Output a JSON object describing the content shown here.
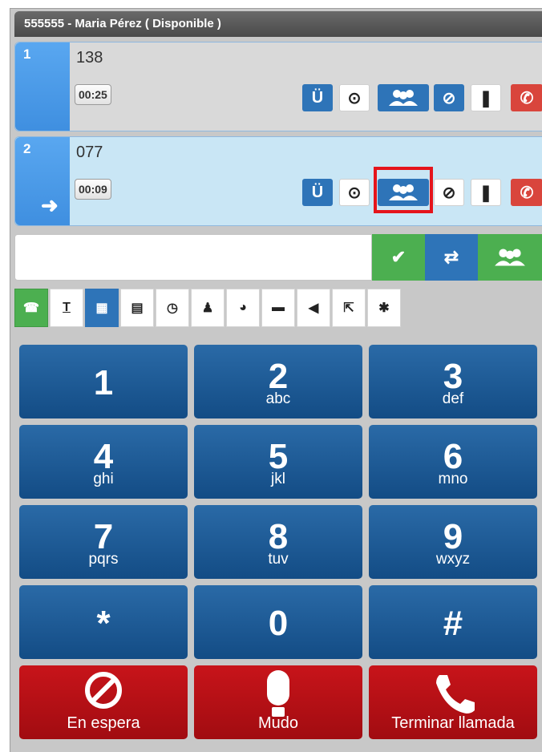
{
  "header": {
    "title": "555555 - Maria Pérez ( Disponible )"
  },
  "calls": [
    {
      "index": "1",
      "extension": "138",
      "timer": "00:25"
    },
    {
      "index": "2",
      "extension": "077",
      "timer": "00:09"
    }
  ],
  "dial": {
    "value": ""
  },
  "tabs": [
    "phone",
    "text",
    "keypad",
    "list",
    "history",
    "contact",
    "globe",
    "chat",
    "broadcast",
    "export",
    "settings"
  ],
  "keypad": [
    {
      "digit": "1",
      "letters": ""
    },
    {
      "digit": "2",
      "letters": "abc"
    },
    {
      "digit": "3",
      "letters": "def"
    },
    {
      "digit": "4",
      "letters": "ghi"
    },
    {
      "digit": "5",
      "letters": "jkl"
    },
    {
      "digit": "6",
      "letters": "mno"
    },
    {
      "digit": "7",
      "letters": "pqrs"
    },
    {
      "digit": "8",
      "letters": "tuv"
    },
    {
      "digit": "9",
      "letters": "wxyz"
    },
    {
      "digit": "*",
      "letters": ""
    },
    {
      "digit": "0",
      "letters": ""
    },
    {
      "digit": "#",
      "letters": ""
    }
  ],
  "function_buttons": {
    "hold": "En espera",
    "mute": "Mudo",
    "end": "Terminar llamada"
  },
  "colors": {
    "accent_blue": "#2e74b8",
    "end_red": "#b5101a",
    "accept_green": "#4caf50"
  }
}
